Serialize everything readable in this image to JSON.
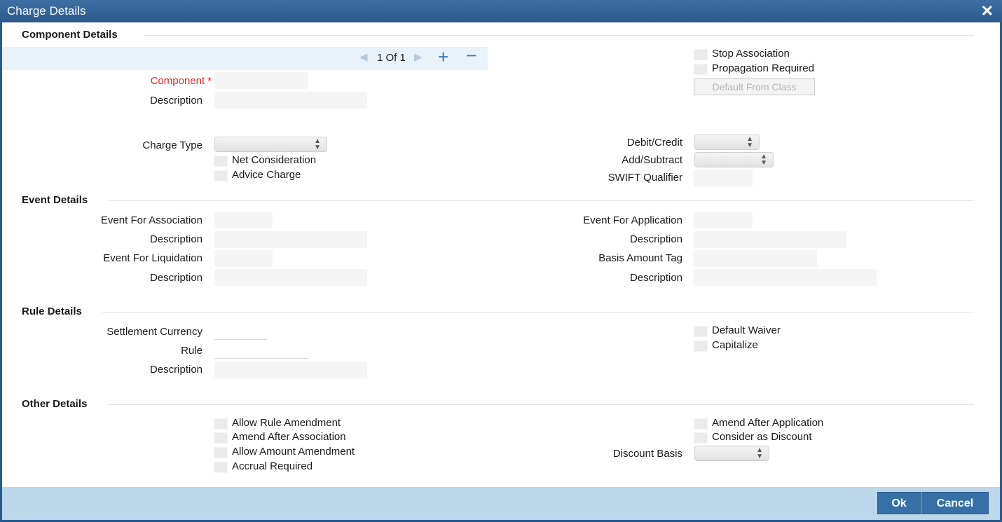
{
  "window": {
    "title": "Charge Details",
    "close_icon": "close-icon"
  },
  "component_details": {
    "title": "Component Details",
    "nav": {
      "position": "1 Of  1",
      "add_icon": "plus-icon",
      "remove_icon": "minus-icon",
      "prev_icon": "prev-arrow-icon",
      "next_icon": "next-arrow-icon"
    },
    "component_label": "Component",
    "required_marker": "*",
    "component_value": "",
    "description_label": "Description",
    "description_value": "",
    "stop_association": "Stop Association",
    "propagation_required": "Propagation Required",
    "default_from_class": "Default From Class",
    "charge_type_label": "Charge Type",
    "net_consideration": "Net Consideration",
    "advice_charge": "Advice Charge",
    "debit_credit_label": "Debit/Credit",
    "add_subtract_label": "Add/Subtract",
    "swift_qualifier_label": "SWIFT Qualifier"
  },
  "event_details": {
    "title": "Event Details",
    "event_for_association": "Event For Association",
    "description_1": "Description",
    "event_for_liquidation": "Event For Liquidation",
    "description_2": "Description",
    "event_for_application": "Event For Application",
    "description_3": "Description",
    "basis_amount_tag": "Basis Amount Tag",
    "description_4": "Description"
  },
  "rule_details": {
    "title": "Rule Details",
    "settlement_currency": "Settlement Currency",
    "rule": "Rule",
    "description": "Description",
    "default_waiver": "Default Waiver",
    "capitalize": "Capitalize"
  },
  "other_details": {
    "title": "Other Details",
    "allow_rule_amendment": "Allow Rule Amendment",
    "amend_after_association": "Amend After Association",
    "allow_amount_amendment": "Allow Amount Amendment",
    "accrual_required": "Accrual Required",
    "amend_after_application": "Amend After Application",
    "consider_as_discount": "Consider as Discount",
    "discount_basis": "Discount Basis"
  },
  "footer": {
    "ok": "Ok",
    "cancel": "Cancel"
  },
  "colors": {
    "title_bar": "#2b5a8c",
    "footer": "#bcd6ea",
    "button": "#3670a6",
    "required": "#e0262a"
  }
}
